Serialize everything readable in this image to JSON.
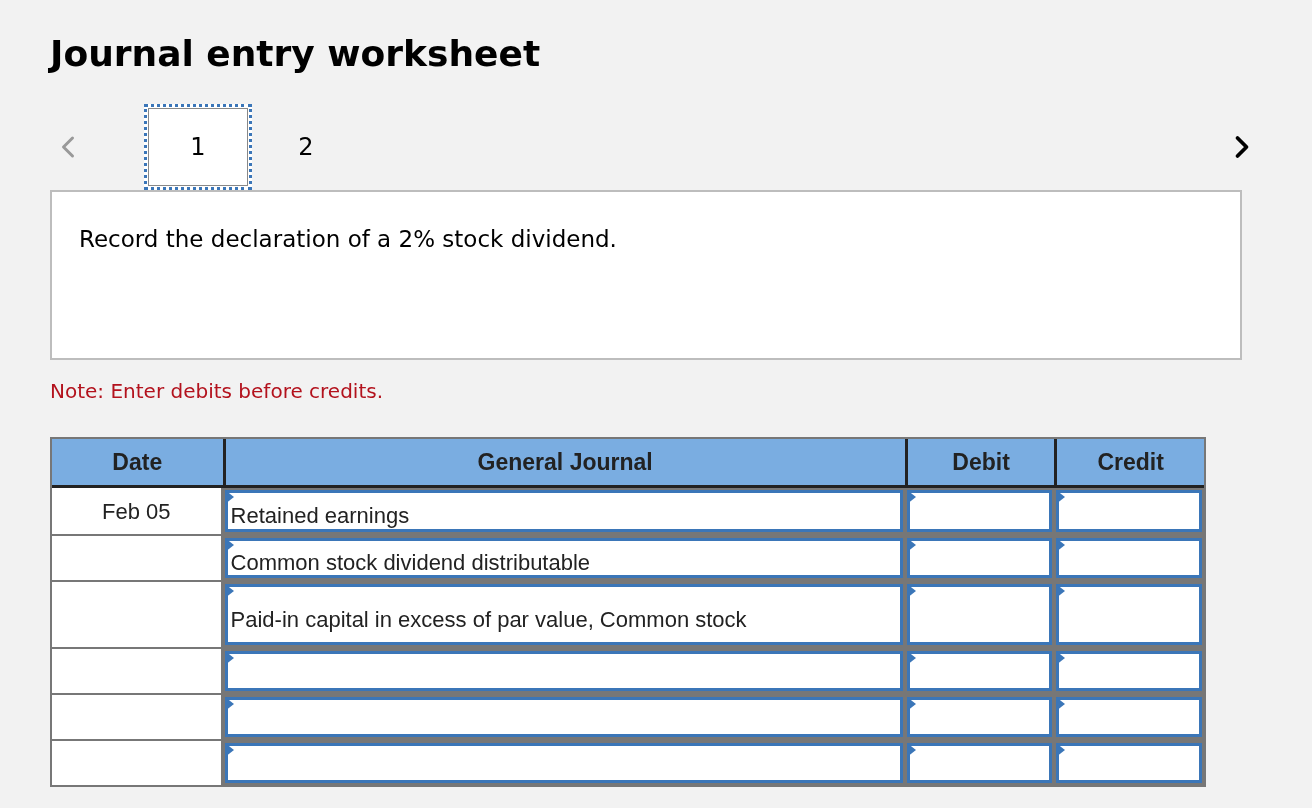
{
  "title": "Journal entry worksheet",
  "nav": {
    "prev_disabled": true,
    "next_disabled": false
  },
  "tabs": [
    {
      "label": "1",
      "selected": true
    },
    {
      "label": "2",
      "selected": false
    }
  ],
  "prompt": "Record the declaration of a 2% stock dividend.",
  "note": "Note: Enter debits before credits.",
  "table": {
    "columns": [
      "Date",
      "General Journal",
      "Debit",
      "Credit"
    ],
    "rows": [
      {
        "date": "Feb 05",
        "account": "Retained earnings"
      },
      {
        "account": "Common stock dividend distributable"
      },
      {
        "account": "Paid-in capital in excess of par value, Common stock"
      },
      {},
      {},
      {}
    ]
  }
}
